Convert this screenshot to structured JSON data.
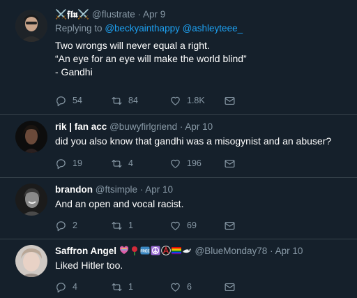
{
  "tweets": [
    {
      "name": "⚔️𝖋𝖑𝖚⚔️",
      "handle": "@flustrate",
      "date": "Apr 9",
      "reply_to_prefix": "Replying to",
      "reply_to_mentions": "@beckyainthappy @ashleyteee_",
      "text": "Two wrongs will never equal a right.\n“An eye for an eye will make the world blind”\n            - Gandhi",
      "replies": "54",
      "retweets": "84",
      "likes": "1.8K"
    },
    {
      "name": "rik | fan acc",
      "handle": "@buwyfirlgriend",
      "date": "Apr 10",
      "text": "did you also know that gandhi was a misogynist and an abuser?",
      "replies": "19",
      "retweets": "4",
      "likes": "196"
    },
    {
      "name": "brandon",
      "handle": "@ftsimple",
      "date": "Apr 10",
      "text": "And an open and vocal racist.",
      "replies": "2",
      "retweets": "1",
      "likes": "69"
    },
    {
      "name": "Saffron Angel",
      "handle": "@BlueMonday78",
      "date": "Apr 10",
      "name_emojis": [
        "heart-emoji",
        "rose-emoji",
        "free-emoji",
        "peace-emoji",
        "anarchy-emoji",
        "rainbow-flag-emoji",
        "bird-emoji"
      ],
      "text": "Liked Hitler too.",
      "replies": "4",
      "retweets": "1",
      "likes": "6"
    }
  ],
  "separator": "·",
  "colors": {
    "background": "#15202b",
    "text": "#ffffff",
    "secondary": "#8899a6",
    "link": "#1da1f2",
    "divider": "#38444d"
  }
}
